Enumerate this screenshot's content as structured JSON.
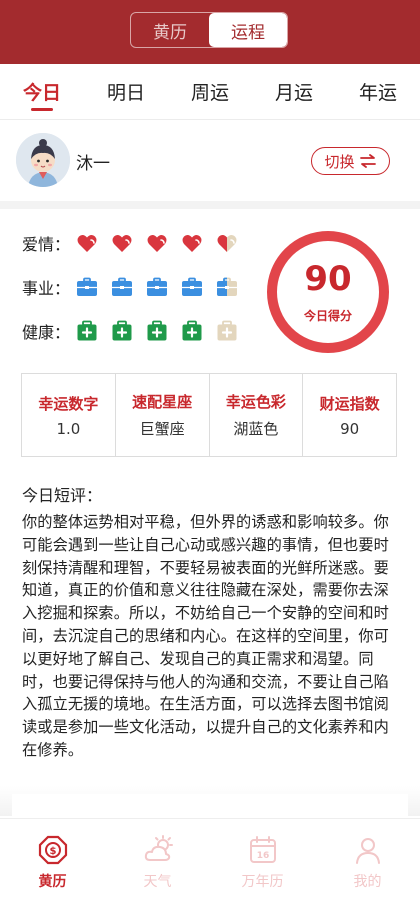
{
  "header": {
    "segments": [
      {
        "label": "黄历",
        "active": false
      },
      {
        "label": "运程",
        "active": true
      }
    ]
  },
  "tabs": [
    {
      "label": "今日",
      "active": true
    },
    {
      "label": "明日",
      "active": false
    },
    {
      "label": "周运",
      "active": false
    },
    {
      "label": "月运",
      "active": false
    },
    {
      "label": "年运",
      "active": false
    }
  ],
  "user": {
    "name": "沐一",
    "switch_label": "切换"
  },
  "ratings": [
    {
      "label": "爱情：",
      "icon": "heart-icon",
      "level": 4.5,
      "max": 5
    },
    {
      "label": "事业：",
      "icon": "briefcase-icon",
      "level": 4.5,
      "max": 5
    },
    {
      "label": "健康：",
      "icon": "medkit-icon",
      "level": 4,
      "max": 5
    }
  ],
  "score": {
    "value": "90",
    "label": "今日得分",
    "percent": 90
  },
  "stats": [
    {
      "title": "幸运数字",
      "value": "1.0"
    },
    {
      "title": "速配星座",
      "value": "巨蟹座"
    },
    {
      "title": "幸运色彩",
      "value": "湖蓝色"
    },
    {
      "title": "财运指数",
      "value": "90"
    }
  ],
  "comment": {
    "title": "今日短评：",
    "body": "你的整体运势相对平稳，但外界的诱惑和影响较多。你可能会遇到一些让自己心动或感兴趣的事情，但也要时刻保持清醒和理智，不要轻易被表面的光鲜所迷惑。要知道，真正的价值和意义往往隐藏在深处，需要你去深入挖掘和探索。所以，不妨给自己一个安静的空间和时间，去沉淀自己的思绪和内心。在这样的空间里，你可以更好地了解自己、发现自己的真正需求和渴望。同时，也要记得保持与他人的沟通和交流，不要让自己陷入孤立无援的境地。在生活方面，可以选择去图书馆阅读或是参加一些文化活动，以提升自己的文化素养和内在修养。"
  },
  "bottom_nav": [
    {
      "label": "黄历",
      "icon": "almanac-icon",
      "active": true
    },
    {
      "label": "天气",
      "icon": "weather-icon",
      "active": false
    },
    {
      "label": "万年历",
      "icon": "calendar-icon",
      "active": false
    },
    {
      "label": "我的",
      "icon": "profile-icon",
      "active": false
    }
  ],
  "colors": {
    "brand_red": "#a32b2e",
    "accent_red": "#c8282d",
    "heart": "#d9363e",
    "briefcase": "#3b8fe0",
    "medkit": "#1f9a4a",
    "inactive_beige": "#e3d6bd",
    "nav_inactive": "#f2c7c8"
  }
}
